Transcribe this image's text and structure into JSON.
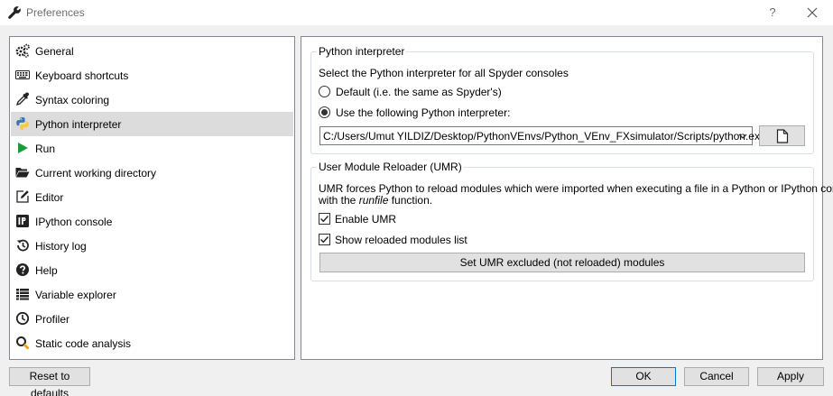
{
  "window": {
    "title": "Preferences",
    "help_label": "?",
    "icon": "wrench-icon"
  },
  "sidebar": {
    "selected": "Python interpreter",
    "items": [
      {
        "label": "General",
        "icon": "gears-icon"
      },
      {
        "label": "Keyboard shortcuts",
        "icon": "keyboard-icon"
      },
      {
        "label": "Syntax coloring",
        "icon": "eyedropper-icon"
      },
      {
        "label": "Python interpreter",
        "icon": "python-icon"
      },
      {
        "label": "Run",
        "icon": "play-icon"
      },
      {
        "label": "Current working directory",
        "icon": "folder-open-icon"
      },
      {
        "label": "Editor",
        "icon": "edit-icon"
      },
      {
        "label": "IPython console",
        "icon": "ipython-icon"
      },
      {
        "label": "History log",
        "icon": "history-icon"
      },
      {
        "label": "Help",
        "icon": "question-circle-icon"
      },
      {
        "label": "Variable explorer",
        "icon": "table-icon"
      },
      {
        "label": "Profiler",
        "icon": "clock-icon"
      },
      {
        "label": "Static code analysis",
        "icon": "magnifier-icon"
      }
    ]
  },
  "interpreter": {
    "group_title": "Python interpreter",
    "description": "Select the Python interpreter for all Spyder consoles",
    "option_default": "Default (i.e. the same as Spyder's)",
    "option_custom": "Use the following Python interpreter:",
    "selected_option": "custom",
    "path": "C:/Users/Umut YILDIZ/Desktop/PythonVEnvs/Python_VEnv_FXsimulator/Scripts/python.exe"
  },
  "umr": {
    "group_title": "User Module Reloader (UMR)",
    "description_line1": "UMR forces Python to reload modules which were imported when executing a file in a Python or IPython console",
    "description_line2_prefix": "with the ",
    "description_line2_italic": "runfile",
    "description_line2_suffix": " function.",
    "enable_label": "Enable UMR",
    "enable_checked": true,
    "show_list_label": "Show reloaded modules list",
    "show_list_checked": true,
    "excluded_button": "Set UMR excluded (not reloaded) modules"
  },
  "footer": {
    "reset_label": "Reset to defaults",
    "ok_label": "OK",
    "cancel_label": "Cancel",
    "apply_label": "Apply"
  }
}
